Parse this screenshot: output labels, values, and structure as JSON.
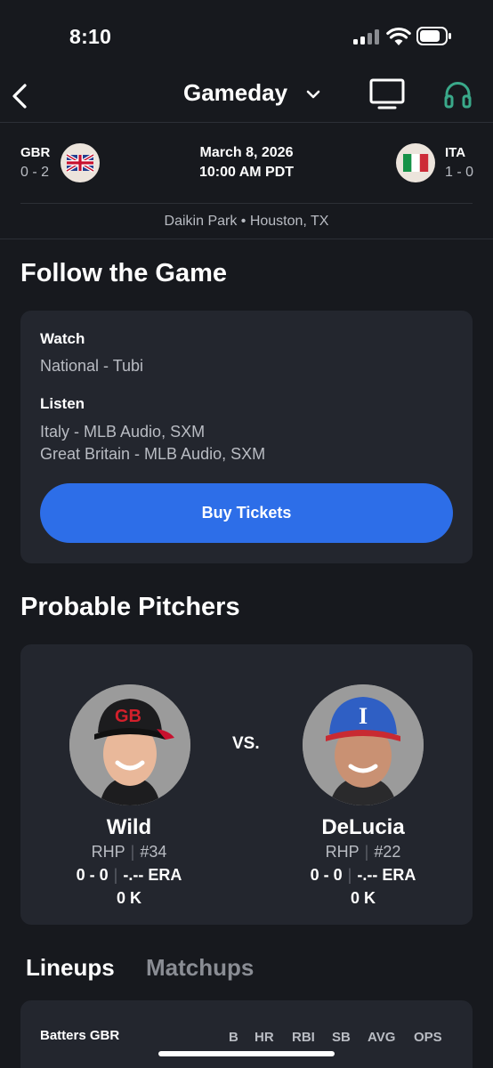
{
  "status": {
    "time": "8:10"
  },
  "nav": {
    "title": "Gameday"
  },
  "game": {
    "away": {
      "abbr": "GBR",
      "record": "0 - 2"
    },
    "home": {
      "abbr": "ITA",
      "record": "1 - 0"
    },
    "date": "March 8, 2026",
    "time": "10:00 AM PDT",
    "venue": "Daikin Park • Houston, TX"
  },
  "follow": {
    "heading": "Follow the Game",
    "watch_label": "Watch",
    "watch_value": "National - Tubi",
    "listen_label": "Listen",
    "listen_values": [
      "Italy - MLB Audio, SXM",
      "Great Britain - MLB Audio, SXM"
    ],
    "tickets_label": "Buy Tickets"
  },
  "pitchers": {
    "heading": "Probable Pitchers",
    "vs": "VS.",
    "left": {
      "name": "Wild",
      "hand": "RHP",
      "number": "#34",
      "record": "0 - 0",
      "era": "-.-- ERA",
      "k": "0 K",
      "cap_logo": "GB"
    },
    "right": {
      "name": "DeLucia",
      "hand": "RHP",
      "number": "#22",
      "record": "0 - 0",
      "era": "-.-- ERA",
      "k": "0 K",
      "cap_logo": "I"
    }
  },
  "tabs": {
    "lineups": "Lineups",
    "matchups": "Matchups"
  },
  "lineups": {
    "batters_label": "Batters GBR",
    "columns": [
      "B",
      "HR",
      "RBI",
      "SB",
      "AVG",
      "OPS"
    ]
  },
  "colors": {
    "background": "#17191e",
    "card": "#23262e",
    "accent_blue": "#2d6ee8",
    "headphones_green": "#3aa98a",
    "secondary_text": "#b9bcc3"
  },
  "icons": [
    "back-chevron-icon",
    "chevron-down-icon",
    "tv-icon",
    "headphones-icon",
    "gbr-flag-icon",
    "ita-flag-icon",
    "signal-icon",
    "wifi-icon",
    "battery-icon"
  ]
}
